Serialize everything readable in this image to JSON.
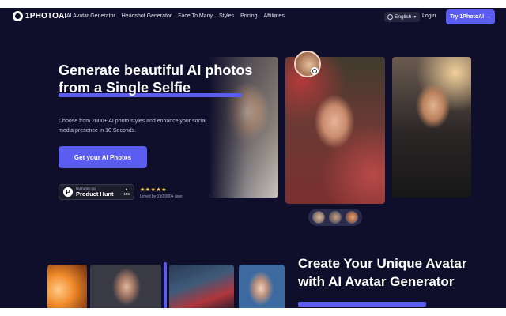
{
  "brand": {
    "name": "1PHOTOAI",
    "accent": "#5b5cf0",
    "background": "#0f0f2b"
  },
  "nav": {
    "links": [
      "AI Avatar Generator",
      "Headshot Generator",
      "Face To Many",
      "Styles",
      "Pricing",
      "Affiliates"
    ],
    "language": "English",
    "login": "Login",
    "try_button": "Try 1PhotoAI →"
  },
  "hero": {
    "title": "Generate beautiful AI photos from a Single Selfie",
    "subtitle": "Choose from 2000+ AI photo styles and enhance your social media presence in 10 Seconds.",
    "cta": "Get your AI Photos",
    "product_hunt": {
      "featured": "FEATURED ON",
      "name": "Product Hunt",
      "count": "145"
    },
    "stars": "★★★★★",
    "loved": "Loved by 150,000+ user"
  },
  "section2": {
    "title": "Create Your Unique Avatar with AI Avatar Generator"
  }
}
